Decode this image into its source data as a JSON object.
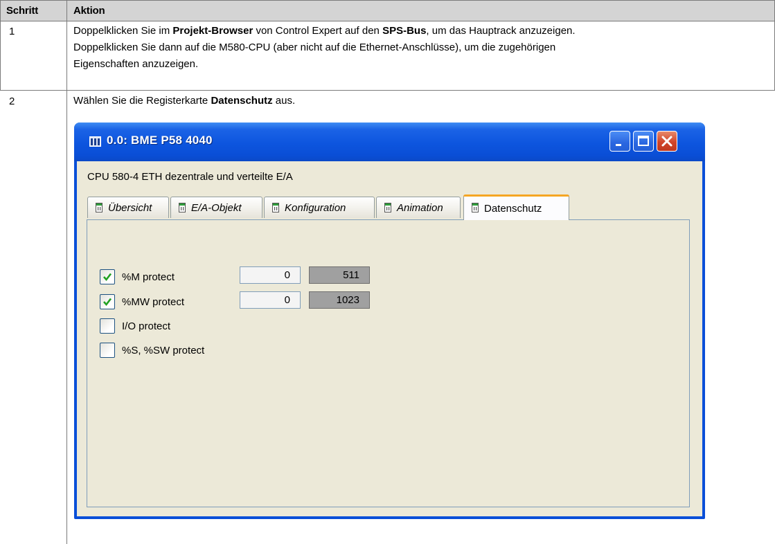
{
  "table": {
    "headers": {
      "step": "Schritt",
      "action": "Aktion"
    },
    "rows": [
      {
        "step": "1",
        "line1_a": "Doppelklicken Sie im ",
        "line1_b": "Projekt-Browser",
        "line1_c": " von Control Expert auf den ",
        "line1_d": "SPS-Bus",
        "line1_e": ", um das Hauptrack anzuzeigen.",
        "line2": "Doppelklicken Sie dann auf die M580-CPU (aber nicht auf die Ethernet-Anschlüsse), um die zugehörigen",
        "line3": "Eigenschaften anzuzeigen."
      },
      {
        "step": "2",
        "text_a": "Wählen Sie die Registerkarte ",
        "text_b": "Datenschutz",
        "text_c": " aus."
      }
    ]
  },
  "dialog": {
    "title": "0.0: BME P58 4040",
    "description": "CPU 580-4 ETH dezentrale und verteilte E/A",
    "tabs": [
      {
        "label": "Übersicht",
        "active": false
      },
      {
        "label": "E/A-Objekt",
        "active": false
      },
      {
        "label": "Konfiguration",
        "active": false
      },
      {
        "label": "Animation",
        "active": false
      },
      {
        "label": "Datenschutz",
        "active": true
      }
    ],
    "options": [
      {
        "label": "%M protect",
        "checked": true,
        "start": "0",
        "end": "511"
      },
      {
        "label": "%MW protect",
        "checked": true,
        "start": "0",
        "end": "1023"
      },
      {
        "label": "I/O protect",
        "checked": false
      },
      {
        "label": "%S, %SW protect",
        "checked": false
      }
    ],
    "colors": {
      "titlebar": "#0a4fd8",
      "client": "#ece9d8",
      "active_tab_accent": "#f5a623",
      "close_button": "#d1452a"
    },
    "icons": {
      "title": "rack-icon",
      "tab": "module-icon",
      "minimize": "minimize-icon",
      "maximize": "maximize-icon",
      "close": "close-icon",
      "check": "checkmark-icon"
    }
  }
}
